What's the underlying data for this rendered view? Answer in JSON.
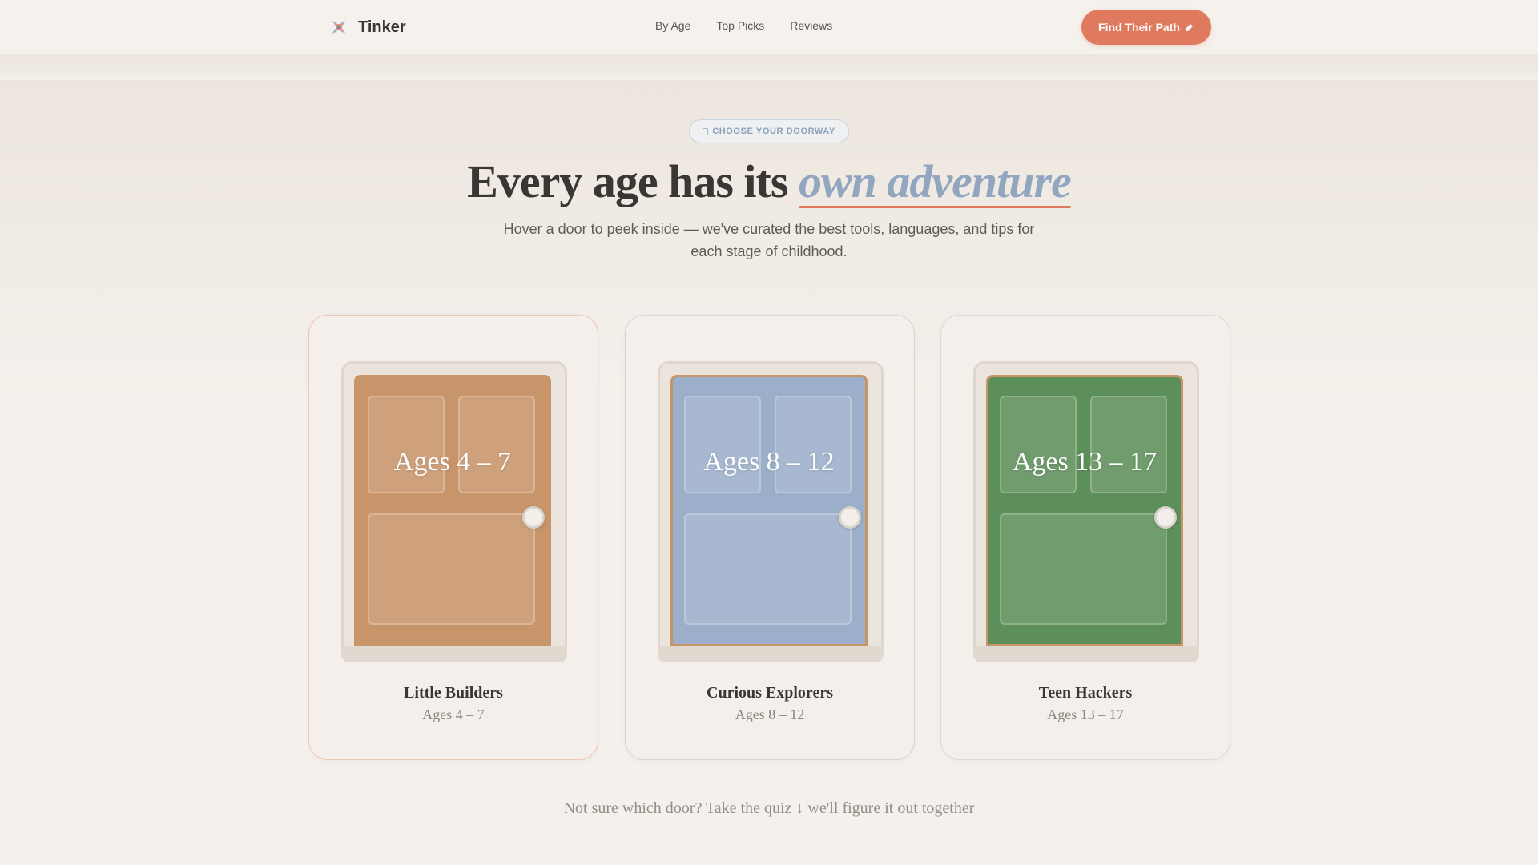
{
  "nav": {
    "brand": "Tinker",
    "links": [
      "By Age",
      "Top Picks",
      "Reviews"
    ],
    "cta_label": "Find Their Path",
    "cta_icon": "pencil-icon"
  },
  "hero": {
    "badge": "CHOOSE YOUR DOORWAY",
    "headline_main": "Every age has its ",
    "headline_accent": "own adventure",
    "subtitle": "Hover a door to peek inside — we've curated the best tools, languages, and tips for each stage of childhood."
  },
  "doors": [
    {
      "label": "Ages 4 – 7",
      "title": "Little Builders",
      "subtitle": "Ages 4 – 7"
    },
    {
      "label": "Ages 8 – 12",
      "title": "Curious Explorers",
      "subtitle": "Ages 8 – 12"
    },
    {
      "label": "Ages 13 – 17",
      "title": "Teen Hackers",
      "subtitle": "Ages 13 – 17"
    }
  ],
  "footer_note": "Not sure which door? Take the quiz ↓ we'll figure it out together",
  "colors": {
    "accent": "#e07a5f",
    "door_orange": "#c8956a",
    "door_blue": "#9bafca",
    "door_green": "#5d8f5a",
    "headline_accent": "#93a6c0"
  }
}
